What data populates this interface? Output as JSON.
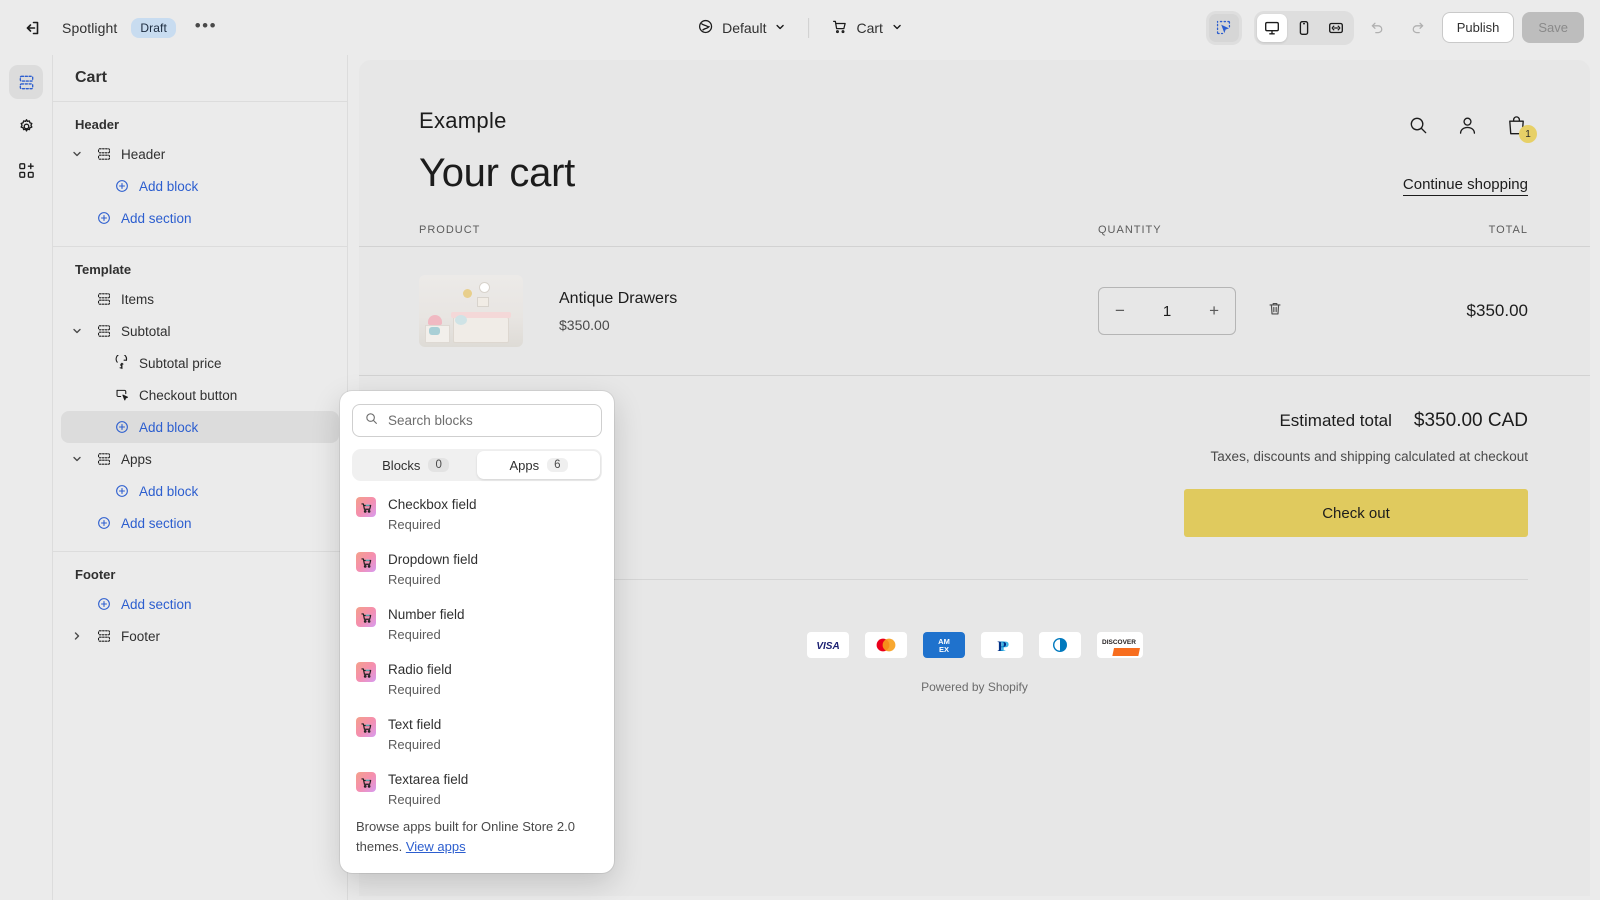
{
  "topbar": {
    "exit_icon": "exit-arrow-icon",
    "theme_name": "Spotlight",
    "status_badge": "Draft",
    "more_label": "•••",
    "locale_icon": "globe-icon",
    "locale_label": "Default",
    "page_icon": "cart-icon",
    "page_label": "Cart",
    "tools": [
      {
        "name": "inspect-tool",
        "icon": "cursor-select-icon",
        "active": true
      },
      {
        "name": "desktop-view",
        "icon": "desktop-icon",
        "active": true
      },
      {
        "name": "mobile-view",
        "icon": "mobile-icon",
        "active": false
      },
      {
        "name": "fullwidth-view",
        "icon": "fullwidth-icon",
        "active": false
      }
    ],
    "undo_icon": "undo-icon",
    "redo_icon": "redo-icon",
    "publish_label": "Publish",
    "save_label": "Save",
    "accent_blue": "#2c5ecf",
    "draft_badge_bg": "#c8dcf0"
  },
  "rail": [
    {
      "name": "sections-rail-icon",
      "icon": "sections-icon",
      "active": true
    },
    {
      "name": "settings-rail-icon",
      "icon": "gear-icon",
      "active": false
    },
    {
      "name": "apps-rail-icon",
      "icon": "app-blocks-icon",
      "active": false
    }
  ],
  "sidebar": {
    "title": "Cart",
    "groups": [
      {
        "heading": "Header",
        "rows": [
          {
            "label": "Header",
            "indent": 0,
            "chevron": "down",
            "icon": "section-icon",
            "type": "section",
            "selected": false
          },
          {
            "label": "Add block",
            "indent": 1,
            "chevron": "none",
            "icon": "plus-circle-icon",
            "type": "link",
            "selected": false
          },
          {
            "label": "Add section",
            "indent": 0,
            "chevron": "none",
            "icon": "plus-circle-icon",
            "type": "link",
            "selected": false
          }
        ]
      },
      {
        "heading": "Template",
        "rows": [
          {
            "label": "Items",
            "indent": 0,
            "chevron": "none",
            "icon": "section-icon",
            "type": "section",
            "selected": false
          },
          {
            "label": "Subtotal",
            "indent": 0,
            "chevron": "down",
            "icon": "section-icon",
            "type": "section",
            "selected": false
          },
          {
            "label": "Subtotal price",
            "indent": 1,
            "chevron": "none",
            "icon": "price-tag-icon",
            "type": "block",
            "selected": false
          },
          {
            "label": "Checkout button",
            "indent": 1,
            "chevron": "none",
            "icon": "button-click-icon",
            "type": "block",
            "selected": false
          },
          {
            "label": "Add block",
            "indent": 1,
            "chevron": "none",
            "icon": "plus-circle-icon",
            "type": "link",
            "selected": true
          },
          {
            "label": "Apps",
            "indent": 0,
            "chevron": "down",
            "icon": "section-icon",
            "type": "section",
            "selected": false
          },
          {
            "label": "Add block",
            "indent": 1,
            "chevron": "none",
            "icon": "plus-circle-icon",
            "type": "link",
            "selected": false
          },
          {
            "label": "Add section",
            "indent": 0,
            "chevron": "none",
            "icon": "plus-circle-icon",
            "type": "link",
            "selected": false
          }
        ]
      },
      {
        "heading": "Footer",
        "rows": [
          {
            "label": "Add section",
            "indent": 0,
            "chevron": "none",
            "icon": "plus-circle-icon",
            "type": "link",
            "selected": false
          },
          {
            "label": "Footer",
            "indent": 0,
            "chevron": "right",
            "icon": "section-icon",
            "type": "section",
            "selected": false
          }
        ]
      }
    ]
  },
  "popover": {
    "search_placeholder": "Search blocks",
    "search_value": "",
    "search_icon": "search-icon",
    "tabs": [
      {
        "label": "Blocks",
        "count": "0",
        "active": false
      },
      {
        "label": "Apps",
        "count": "6",
        "active": true
      }
    ],
    "items": [
      {
        "title": "Checkbox field",
        "subtitle": "Required",
        "icon": "app-cart-icon"
      },
      {
        "title": "Dropdown field",
        "subtitle": "Required",
        "icon": "app-cart-icon"
      },
      {
        "title": "Number field",
        "subtitle": "Required",
        "icon": "app-cart-icon"
      },
      {
        "title": "Radio field",
        "subtitle": "Required",
        "icon": "app-cart-icon"
      },
      {
        "title": "Text field",
        "subtitle": "Required",
        "icon": "app-cart-icon"
      },
      {
        "title": "Textarea field",
        "subtitle": "Required",
        "icon": "app-cart-icon"
      }
    ],
    "footer_text": "Browse apps built for Online Store 2.0 themes. ",
    "footer_link": "View apps"
  },
  "preview": {
    "store_name": "Example",
    "header_icons": [
      {
        "name": "search-icon",
        "badge": null
      },
      {
        "name": "account-icon",
        "badge": null
      },
      {
        "name": "shopping-bag-icon",
        "badge": "1"
      }
    ],
    "cart_badge_color": "#e7d067",
    "page_title": "Your cart",
    "continue_shopping": "Continue shopping",
    "columns": [
      "PRODUCT",
      "QUANTITY",
      "TOTAL"
    ],
    "items": [
      {
        "name": "Antique Drawers",
        "price": "$350.00",
        "quantity": "1",
        "total": "$350.00",
        "image_alt": "nursery-dresser-photo",
        "decrease_label": "−",
        "increase_label": "+",
        "remove_icon": "trash-icon"
      }
    ],
    "estimated_total_label": "Estimated total",
    "estimated_total_value": "$350.00 CAD",
    "tax_note": "Taxes, discounts and shipping calculated at checkout",
    "checkout_label": "Check out",
    "checkout_color": "#e0ca5e",
    "payment_methods": [
      "VISA",
      "Mastercard",
      "AMEX",
      "PayPal",
      "Diners Club",
      "Discover"
    ],
    "powered_by": "Powered by Shopify"
  }
}
